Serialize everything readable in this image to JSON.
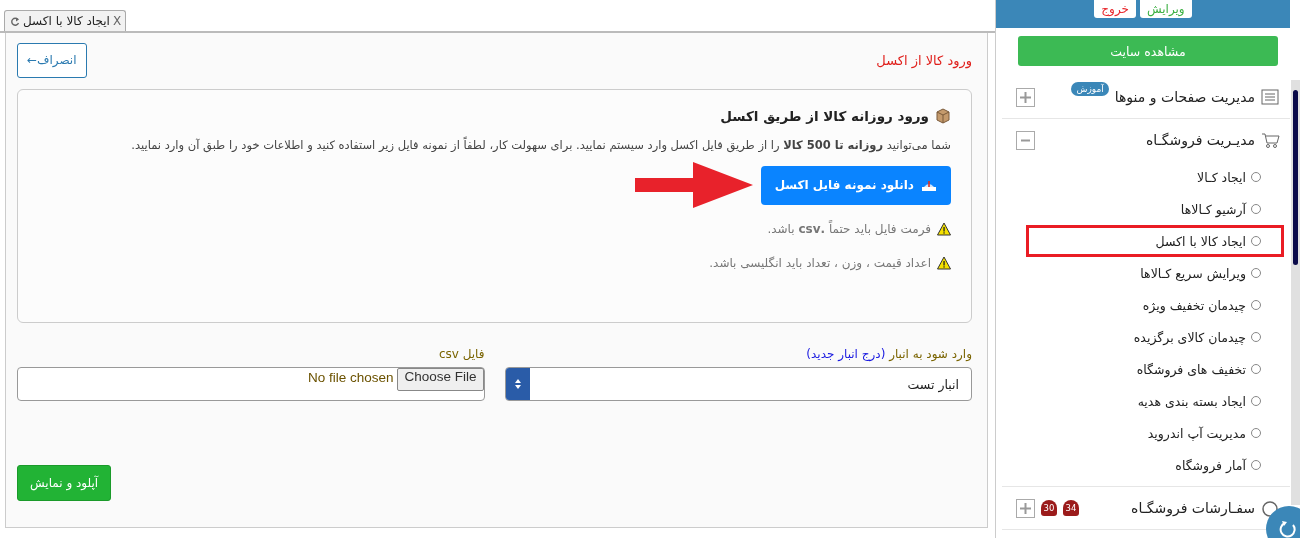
{
  "tab": {
    "title": "ایجاد کالا با اکسل",
    "close": "X"
  },
  "page": {
    "title": "ورود کالا از اکسل",
    "cancel": "انصراف←"
  },
  "card": {
    "heading": "ورود روزانه کالا از طریق اکسل",
    "text": "شما می‌توانید **روزانه تا 500 کالا** را از طریق فایل اکسل وارد سیستم نمایید. برای سهولت کار، لطفاً از نمونه فایل زیر استفاده کنید و اطلاعات خود را طبق آن وارد نمایید.",
    "download": "دانلود نمونه فایل اکسل",
    "notes": [
      "فرمت فایل باید حتماً **.csv** باشد.",
      "اعداد قیمت ، وزن ، تعداد باید انگلیسی باشد."
    ]
  },
  "form": {
    "warehouse_label": "وارد شود به انبار",
    "warehouse_link": "(درج انبار جدید)",
    "warehouse_value": "انبار تست",
    "file_label": "فایل csv",
    "file_button": "Choose File",
    "file_status": "No file chosen",
    "submit": "آپلود و نمایش"
  },
  "sidebar": {
    "header_buttons": [
      {
        "label": "ویرایش",
        "color": "#3cb043"
      },
      {
        "label": "خروج",
        "color": "#e8262b"
      }
    ],
    "view_site": "مشاهده سایت",
    "sections": [
      {
        "label": "مدیریت صفحات و منوها",
        "badge": "آموزش",
        "expanded": false
      },
      {
        "label": "مدیـریت فروشگـاه",
        "expanded": true,
        "children": [
          {
            "label": "ایجاد کـالا",
            "highlighted": false
          },
          {
            "label": "آرشیو کـالاها",
            "highlighted": false
          },
          {
            "label": "ایجاد کالا با اکسل",
            "highlighted": true
          },
          {
            "label": "ویرایش سریع کـالاها",
            "highlighted": false
          },
          {
            "label": "چیدمان تخفیف ویژه",
            "highlighted": false
          },
          {
            "label": "چیدمان کالای برگزیده",
            "highlighted": false
          },
          {
            "label": "تخفیف های فروشگاه",
            "highlighted": false
          },
          {
            "label": "ایجاد بسته بندی هدیه",
            "highlighted": false
          },
          {
            "label": "مدیریت آپ اندروید",
            "highlighted": false
          },
          {
            "label": "آمار فروشگاه",
            "highlighted": false
          }
        ]
      },
      {
        "label": "سفـارشات فروشگـاه",
        "expanded": false,
        "counts": [
          "34",
          "30"
        ]
      }
    ]
  }
}
